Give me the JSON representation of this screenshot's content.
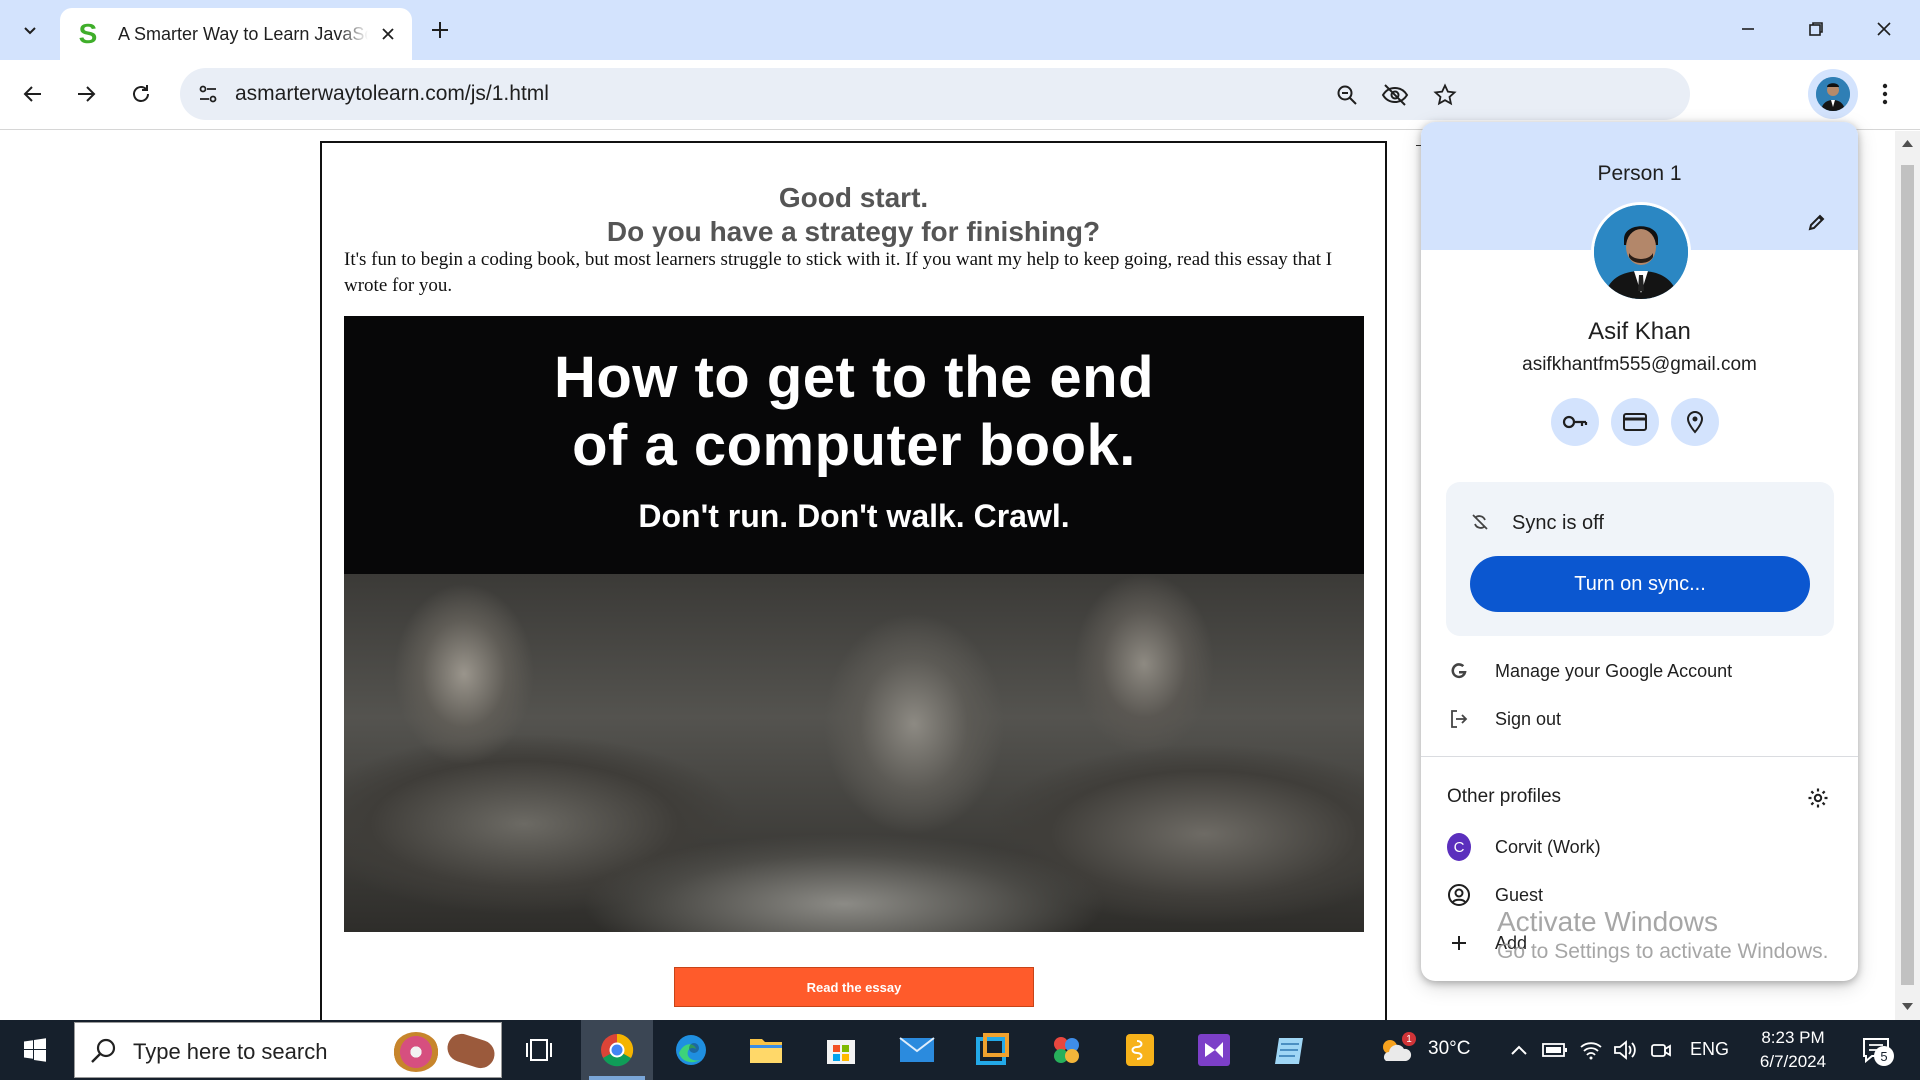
{
  "browser": {
    "tab_title": "A Smarter Way to Learn JavaScript",
    "favicon_letter": "S",
    "url": "asmarterwaytolearn.com/js/1.html",
    "icons": [
      "tab-search-icon",
      "close-icon",
      "plus-icon",
      "minimize-icon",
      "restore-icon",
      "close-window-icon",
      "back-icon",
      "forward-icon",
      "reload-icon",
      "tune-icon",
      "zoom-icon",
      "eye-slash-icon",
      "star-icon",
      "avatar",
      "kebab-menu-icon"
    ]
  },
  "page": {
    "headline_1": "Good start.",
    "headline_2": "Do you have a strategy for finishing?",
    "intro": "It's fun to begin a coding book, but most learners struggle to stick with it. If you want my help to keep going, read this essay that I wrote for you.",
    "banner_line_1": "How to get to the end",
    "banner_line_2": "of a computer book.",
    "banner_sub": "Don't run. Don't walk. Crawl.",
    "read_button": "Read the essay"
  },
  "profile": {
    "person_label": "Person 1",
    "name": "Asif Khan",
    "email": "asifkhantfm555@gmail.com",
    "quick_icons": [
      "key-icon",
      "credit-card-icon",
      "location-pin-icon"
    ],
    "sync_status": "Sync is off",
    "sync_button": "Turn on sync...",
    "manage_account": "Manage your Google Account",
    "sign_out": "Sign out",
    "other_profiles_heading": "Other profiles",
    "profiles": [
      {
        "badge": "C",
        "label": "Corvit (Work)"
      },
      {
        "label": "Guest"
      }
    ],
    "add_label": "Add"
  },
  "watermark": {
    "line_1": "Activate Windows",
    "line_2": "Go to Settings to activate Windows."
  },
  "taskbar": {
    "search_placeholder": "Type here to search",
    "temperature": "30°C",
    "weather_badge": "1",
    "language": "ENG",
    "time": "8:23 PM",
    "date": "6/7/2024",
    "notification_count": "5",
    "apps": [
      "task-view-icon",
      "chrome-icon",
      "edge-icon",
      "file-explorer-icon",
      "microsoft-store-icon",
      "mail-icon",
      "remote-app-icon",
      "office-app-icon",
      "notes-app-icon",
      "visual-studio-icon",
      "notepad-app-icon"
    ]
  },
  "colors": {
    "tabstrip": "#d3e3fd",
    "omnibox": "#e9eef6",
    "sync_button": "#0b57d0",
    "read_button": "#ff5b2b",
    "taskbar": "#16202c",
    "headline": "#555555"
  }
}
